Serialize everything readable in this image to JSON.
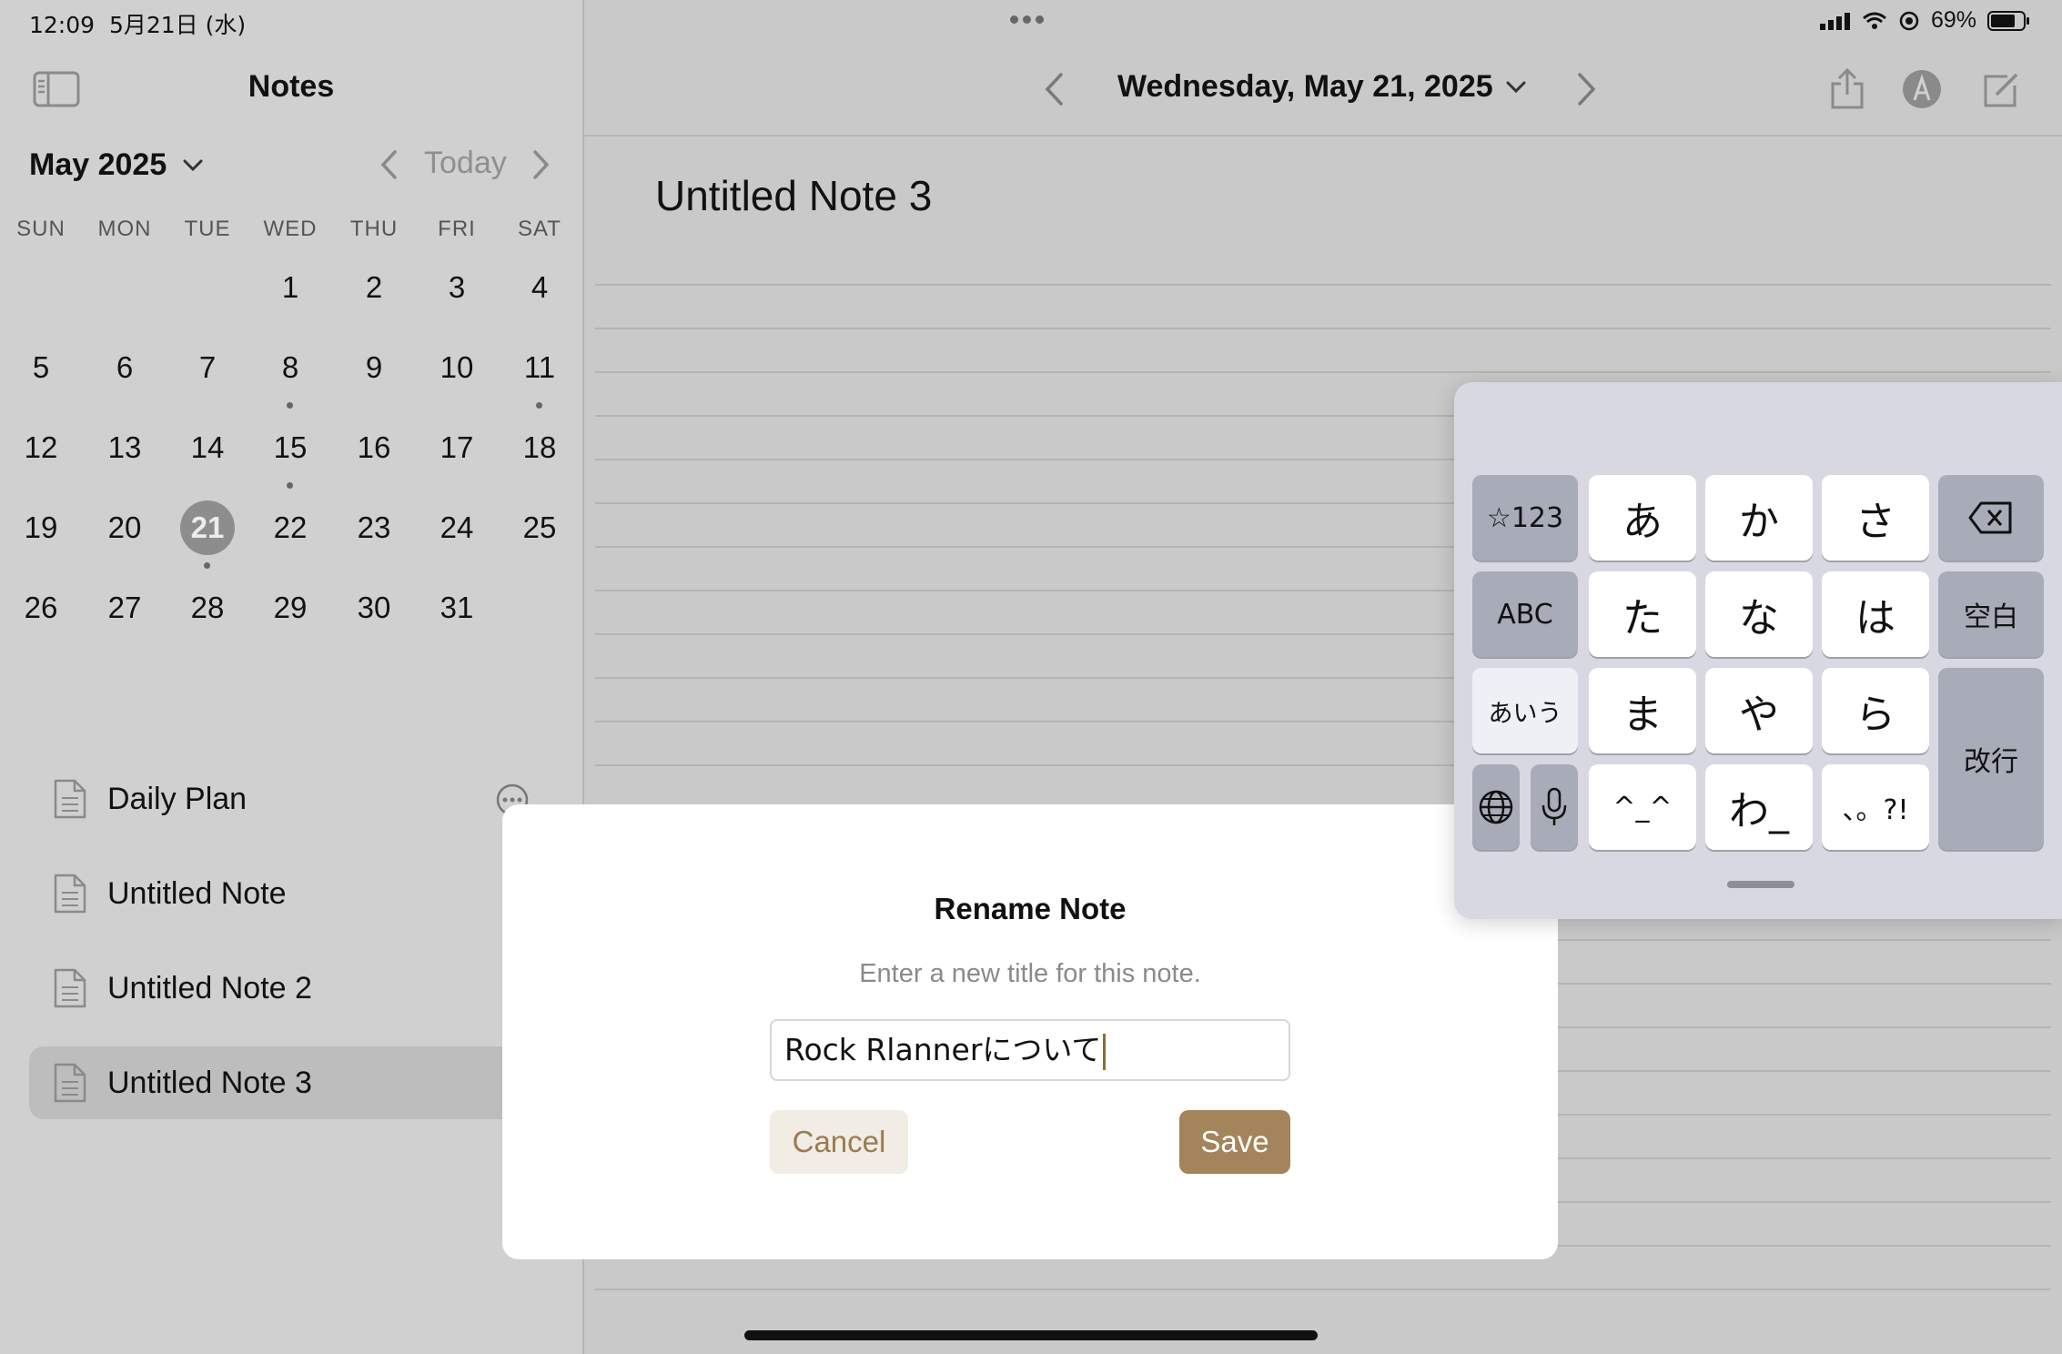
{
  "status_bar": {
    "time": "12:09",
    "date": "5月21日 (水)",
    "battery": "69%"
  },
  "sidebar": {
    "title": "Notes",
    "month_label": "May 2025",
    "today_label": "Today",
    "weekdays": [
      "SUN",
      "MON",
      "TUE",
      "WED",
      "THU",
      "FRI",
      "SAT"
    ],
    "weeks": [
      [
        "",
        "",
        "",
        "1",
        "2",
        "3",
        "4"
      ],
      [
        "5",
        "6",
        "7",
        "8",
        "9",
        "10",
        "11"
      ],
      [
        "12",
        "13",
        "14",
        "15",
        "16",
        "17",
        "18"
      ],
      [
        "19",
        "20",
        "21",
        "22",
        "23",
        "24",
        "25"
      ],
      [
        "26",
        "27",
        "28",
        "29",
        "30",
        "31",
        ""
      ]
    ],
    "selected_day": "21",
    "days_with_notes": [
      "8",
      "11",
      "15",
      "21"
    ],
    "notes": [
      {
        "label": "Daily Plan"
      },
      {
        "label": "Untitled Note"
      },
      {
        "label": "Untitled Note 2"
      },
      {
        "label": "Untitled Note 3"
      }
    ],
    "active_note_index": 3
  },
  "toolbar": {
    "date_title": "Wednesday, May 21, 2025"
  },
  "editor": {
    "note_title": "Untitled Note 3"
  },
  "dialog": {
    "title": "Rename Note",
    "message": "Enter a new title for this note.",
    "input_value": "Rock Rlannerについて",
    "cancel_label": "Cancel",
    "save_label": "Save"
  },
  "keyboard": {
    "keys": {
      "num": "☆123",
      "a": "あ",
      "ka": "か",
      "sa": "さ",
      "abc": "ABC",
      "ta": "た",
      "na": "な",
      "ha": "は",
      "space": "空白",
      "aiu": "あいう",
      "ma": "ま",
      "ya": "や",
      "ra": "ら",
      "enter": "改行",
      "emoji": "^_^",
      "wa": "わ_",
      "punct": "、。?!"
    }
  },
  "colors": {
    "accent": "#a4845a",
    "accent_light": "#f1ece4"
  }
}
